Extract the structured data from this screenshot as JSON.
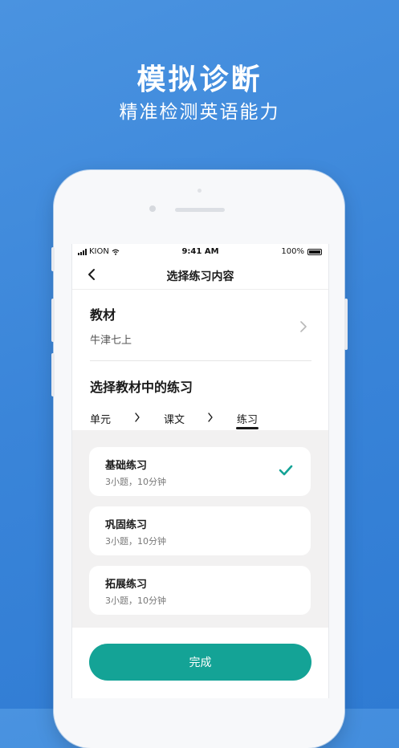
{
  "promo": {
    "title": "模拟诊断",
    "subtitle": "精准检测英语能力"
  },
  "status_bar": {
    "carrier": "KION",
    "time": "9:41 AM",
    "battery": "100%"
  },
  "nav": {
    "title": "选择练习内容"
  },
  "textbook": {
    "label": "教材",
    "value": "牛津七上"
  },
  "exercise_section": {
    "label": "选择教材中的练习"
  },
  "breadcrumb": {
    "items": [
      "单元",
      "课文",
      "练习"
    ],
    "active_index": 2
  },
  "cards": [
    {
      "title": "基础练习",
      "meta": "3小题，10分钟",
      "selected": true
    },
    {
      "title": "巩固练习",
      "meta": "3小题，10分钟",
      "selected": false
    },
    {
      "title": "拓展练习",
      "meta": "3小题，10分钟",
      "selected": false
    }
  ],
  "footer": {
    "done_label": "完成"
  },
  "colors": {
    "accent": "#14a396",
    "background": "#3a85d9"
  },
  "icons": {
    "back": "chevron-left-icon",
    "forward": "chevron-right-icon",
    "check": "check-icon"
  }
}
